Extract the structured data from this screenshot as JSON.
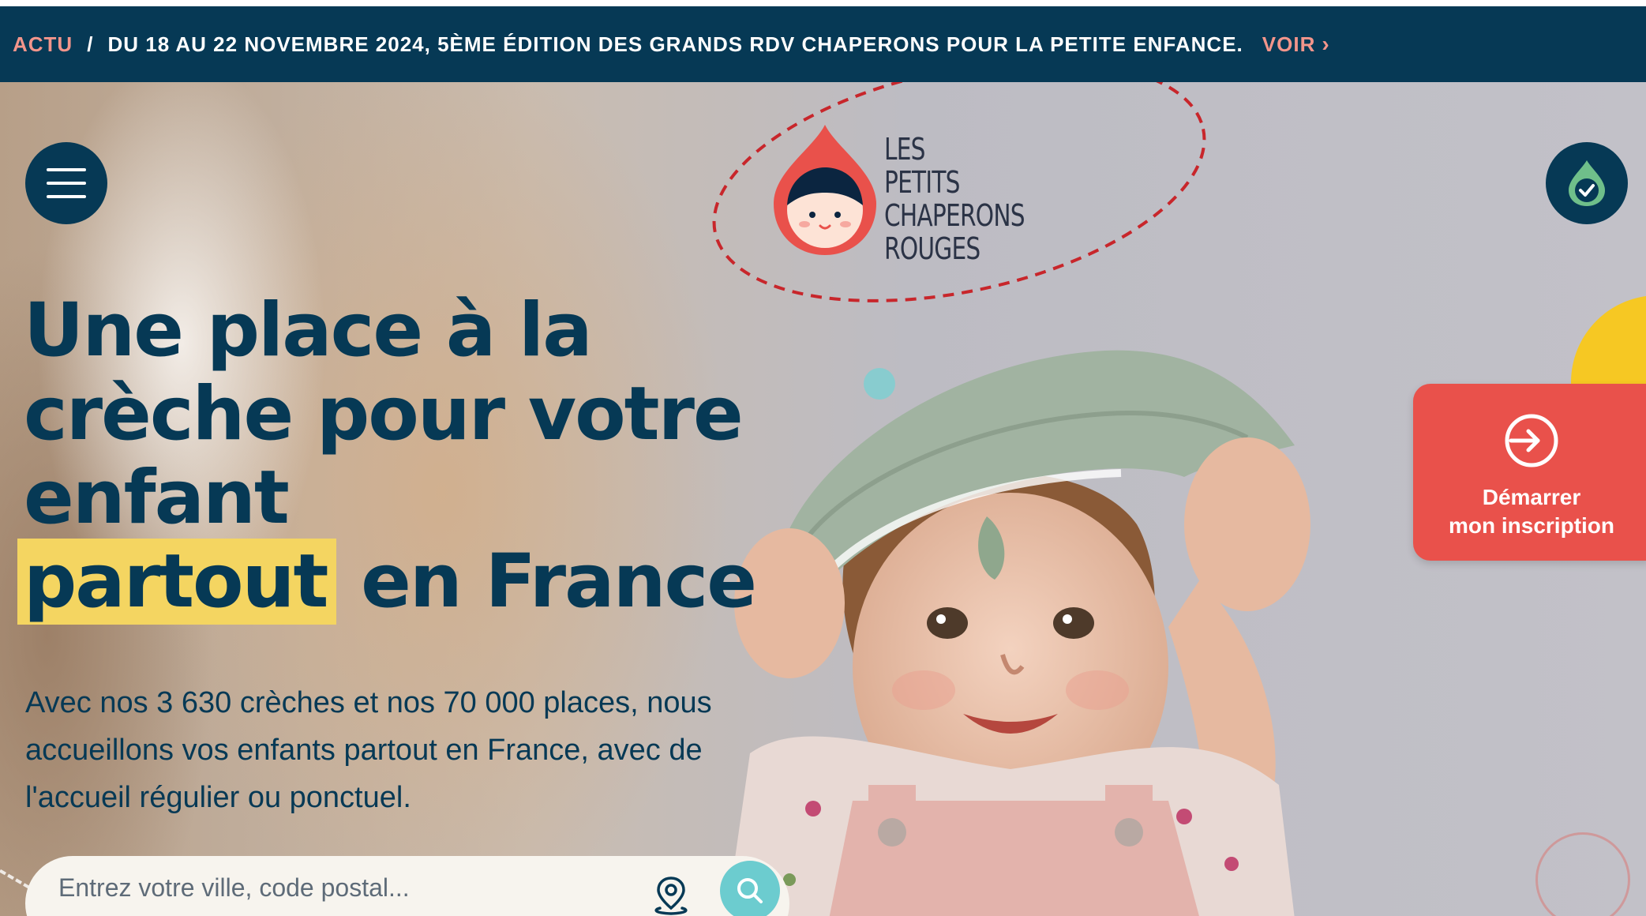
{
  "announcement": {
    "tag": "ACTU",
    "separator": "/",
    "text": "DU 18 AU 22 NOVEMBRE 2024, 5ÈME ÉDITION DES GRANDS RDV CHAPERONS POUR LA PETITE ENFANCE.",
    "link_label": "VOIR",
    "link_icon": "chevron-right-icon",
    "chevron": "›"
  },
  "header": {
    "menu_icon": "hamburger-menu-icon",
    "account_icon": "drop-check-icon",
    "logo": {
      "line1": "LES PETITS",
      "line2": "CHAPERONS",
      "line3": "ROUGES"
    }
  },
  "hero": {
    "headline": {
      "line1": "Une place à la",
      "line2": "crèche pour votre",
      "line3": "enfant",
      "highlight": "partout",
      "line4_rest": " en France"
    },
    "subtitle": {
      "line1": "Avec nos 3 630 crèches et nos 70 000 places, nous",
      "line2": "accueillons vos enfants partout en France, avec de",
      "line3": "l'accueil régulier ou ponctuel."
    }
  },
  "search": {
    "placeholder": "Entrez votre ville, code postal...",
    "value": "",
    "geo_icon": "location-pin-icon",
    "search_icon": "search-icon"
  },
  "cta": {
    "icon": "sign-in-arrow-icon",
    "line1": "Démarrer",
    "line2": "mon inscription"
  },
  "colors": {
    "navy": "#063955",
    "coral": "#e9514b",
    "salmon": "#f2958b",
    "highlight_yellow": "#f4d561",
    "teal": "#6ccccf",
    "deco_yellow": "#f6c823"
  }
}
